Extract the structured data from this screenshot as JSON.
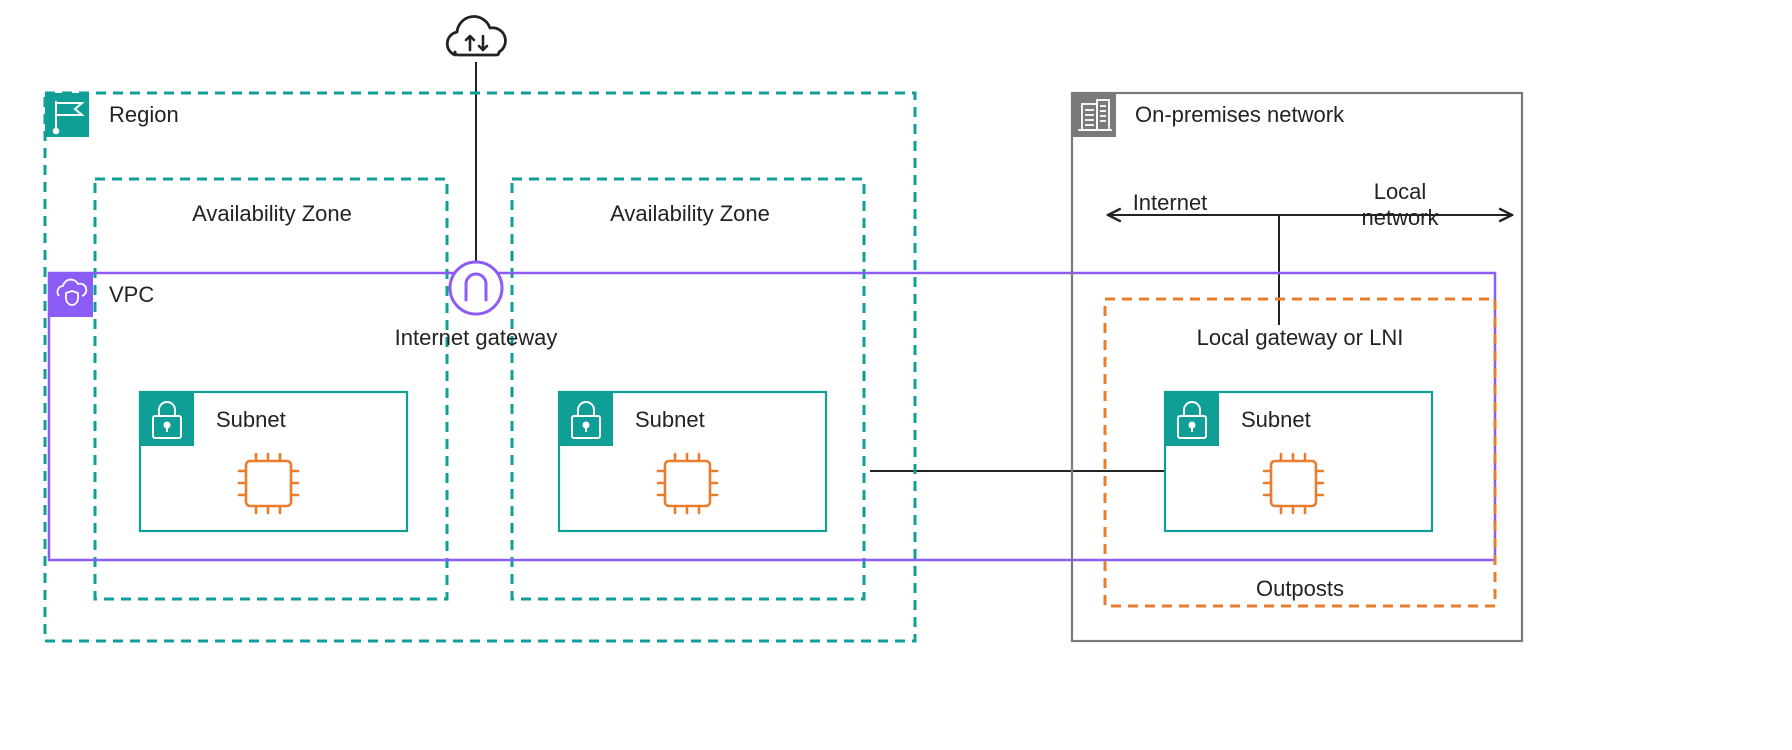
{
  "region": {
    "label": "Region"
  },
  "az1": {
    "label": "Availability Zone"
  },
  "az2": {
    "label": "Availability Zone"
  },
  "vpc": {
    "label": "VPC"
  },
  "igw": {
    "label": "Internet gateway"
  },
  "subnet1": {
    "label": "Subnet"
  },
  "subnet2": {
    "label": "Subnet"
  },
  "onprem": {
    "label": "On-premises network"
  },
  "internet": {
    "label": "Internet"
  },
  "localnet": {
    "label": "Local",
    "label2": "network"
  },
  "lgw": {
    "label": "Local gateway or LNI"
  },
  "subnet3": {
    "label": "Subnet"
  },
  "outposts": {
    "label": "Outposts"
  },
  "colors": {
    "teal": "#0F9F96",
    "purple": "#8B5CF6",
    "orange": "#E97D2E",
    "orange_dark": "#D97706",
    "gray": "#7A7A7A",
    "black": "#232323"
  }
}
